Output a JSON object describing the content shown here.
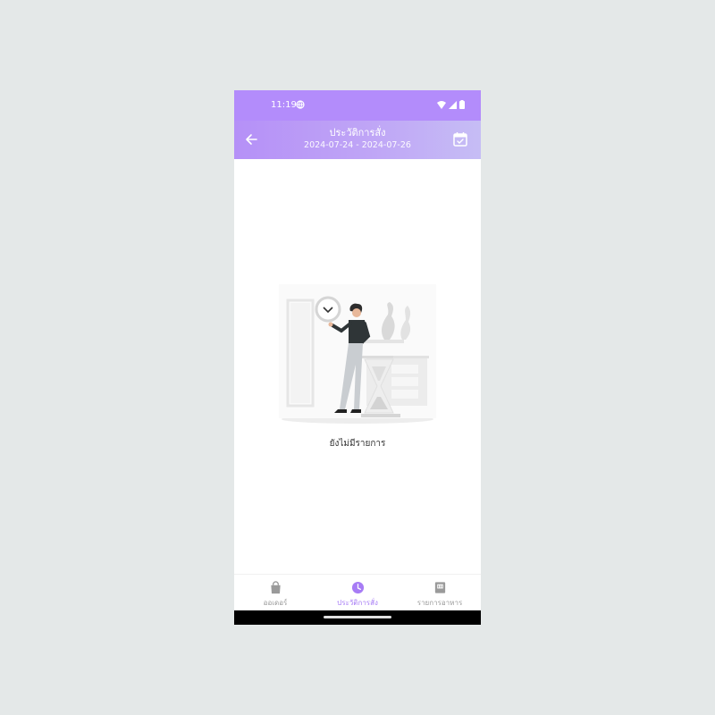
{
  "status_bar": {
    "time": "11:19"
  },
  "header": {
    "title": "ประวัติการสั่ง",
    "date_range": "2024-07-24 - 2024-07-26",
    "back_icon": "arrow-left-icon",
    "calendar_icon": "calendar-check-icon"
  },
  "empty_state": {
    "message": "ยังไม่มีรายการ"
  },
  "bottom_nav": {
    "items": [
      {
        "label": "ออเดอร์",
        "icon": "shopping-bag-icon",
        "active": false
      },
      {
        "label": "ประวัติการสั่ง",
        "icon": "clock-icon",
        "active": true
      },
      {
        "label": "รายการอาหาร",
        "icon": "menu-book-icon",
        "active": false
      }
    ]
  },
  "colors": {
    "accent": "#a77cf5",
    "header_start": "#b590f7",
    "header_end": "#c6bdf5",
    "inactive": "#9a9a9a"
  }
}
